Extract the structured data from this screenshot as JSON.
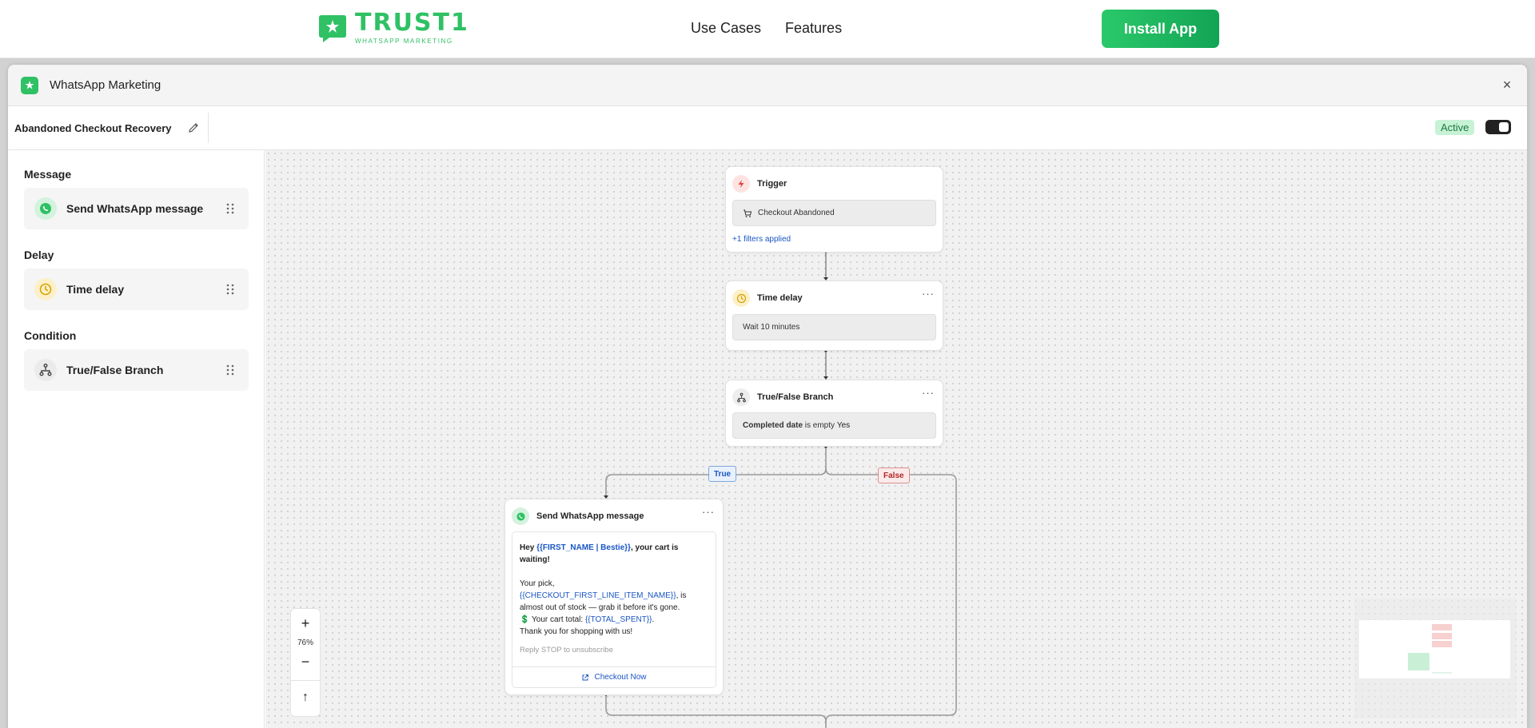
{
  "site": {
    "brand_name": "TRUST1",
    "brand_tagline": "WHATSAPP MARKETING",
    "nav": [
      "Use Cases",
      "Features"
    ],
    "install_label": "Install App"
  },
  "app": {
    "title": "WhatsApp Marketing",
    "close_glyph": "×",
    "flow_name": "Abandoned Checkout Recovery",
    "status": "Active",
    "active_toggle_on": true
  },
  "palette": {
    "message_heading": "Message",
    "message_item": "Send WhatsApp message",
    "delay_heading": "Delay",
    "delay_item": "Time delay",
    "condition_heading": "Condition",
    "condition_item": "True/False Branch"
  },
  "flow": {
    "trigger": {
      "title": "Trigger",
      "event": "Checkout Abandoned",
      "filters": "+1 filters applied"
    },
    "delay": {
      "title": "Time delay",
      "value": "Wait 10 minutes",
      "more": "···"
    },
    "branch": {
      "title": "True/False Branch",
      "condition_field": "Completed date",
      "condition_op": " is empty ",
      "condition_value": "Yes",
      "more": "···",
      "true_label": "True",
      "false_label": "False"
    },
    "message": {
      "title": "Send WhatsApp message",
      "more": "···",
      "greeting_prefix": "Hey ",
      "greeting_var": "{{FIRST_NAME | Bestie}}",
      "greeting_suffix": ", your cart is waiting!",
      "pick_prefix": "Your pick, ",
      "pick_var": "{{CHECKOUT_FIRST_LINE_ITEM_NAME}}",
      "pick_suffix": ", is almost out of stock — grab it before it's gone.",
      "total_emoji": "💲",
      "total_prefix": " Your cart total: ",
      "total_var": "{{TOTAL_SPENT}}",
      "total_suffix": ".",
      "thanks": "Thank you for shopping with us!",
      "footer": "Reply STOP to unsubscribe",
      "cta": "Checkout Now"
    }
  },
  "zoom": {
    "in": "+",
    "level": "76%",
    "out": "−",
    "fit": "↑"
  },
  "colors": {
    "brand_green": "#2fc164",
    "true_blue": "#1a56c4",
    "false_red": "#b52727",
    "trigger_red": "#e0443d",
    "delay_amber": "#d9a300"
  }
}
